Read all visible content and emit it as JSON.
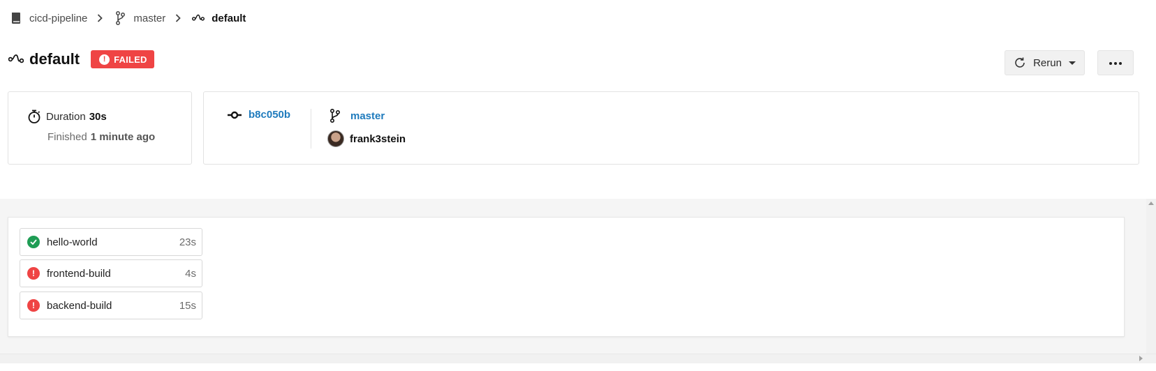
{
  "breadcrumb": {
    "repo": "cicd-pipeline",
    "branch": "master",
    "pipeline": "default"
  },
  "header": {
    "title": "default",
    "status_badge": "FAILED",
    "rerun_label": "Rerun"
  },
  "summary": {
    "duration_label": "Duration",
    "duration_value": "30s",
    "finished_label": "Finished",
    "finished_value": "1 minute ago"
  },
  "commit": {
    "sha": "b8c050b",
    "branch": "master",
    "author": "frank3stein"
  },
  "jobs": [
    {
      "name": "hello-world",
      "duration": "23s",
      "status": "success"
    },
    {
      "name": "frontend-build",
      "duration": "4s",
      "status": "failed"
    },
    {
      "name": "backend-build",
      "duration": "15s",
      "status": "failed"
    }
  ],
  "colors": {
    "failed": "#ef4444",
    "success": "#1f9d55",
    "link": "#1f7bbd"
  },
  "icons": {
    "repo": "book-icon",
    "branch": "branch-icon",
    "pipeline": "pipeline-icon",
    "timer": "stopwatch-icon",
    "commit": "commit-icon",
    "refresh": "refresh-icon",
    "more": "more-horizontal-icon"
  }
}
